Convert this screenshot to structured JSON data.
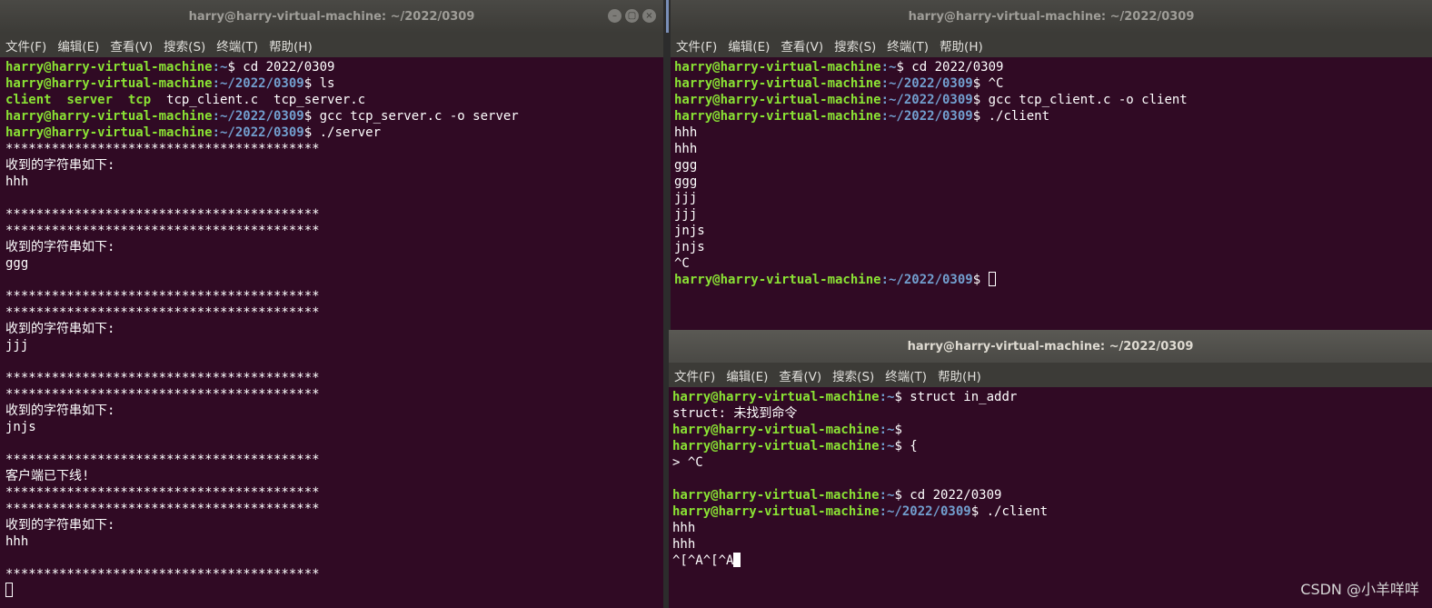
{
  "left_window": {
    "title": "harry@harry-virtual-machine: ~/2022/0309",
    "menu": [
      "文件(F)",
      "编辑(E)",
      "查看(V)",
      "搜索(S)",
      "终端(T)",
      "帮助(H)"
    ],
    "lines": [
      {
        "user": "harry@harry-virtual-machine",
        "path": ":~",
        "cmd": "$ cd 2022/0309"
      },
      {
        "user": "harry@harry-virtual-machine",
        "path": ":~/2022/0309",
        "cmd": "$ ls"
      },
      {
        "listing": "client  server  tcp  ",
        "rest": "tcp_client.c  tcp_server.c"
      },
      {
        "user": "harry@harry-virtual-machine",
        "path": ":~/2022/0309",
        "cmd": "$ gcc tcp_server.c -o server"
      },
      {
        "user": "harry@harry-virtual-machine",
        "path": ":~/2022/0309",
        "cmd": "$ ./server"
      },
      {
        "text": "*****************************************"
      },
      {
        "text": "收到的字符串如下:"
      },
      {
        "text": "hhh"
      },
      {
        "text": ""
      },
      {
        "text": "*****************************************"
      },
      {
        "text": "*****************************************"
      },
      {
        "text": "收到的字符串如下:"
      },
      {
        "text": "ggg"
      },
      {
        "text": ""
      },
      {
        "text": "*****************************************"
      },
      {
        "text": "*****************************************"
      },
      {
        "text": "收到的字符串如下:"
      },
      {
        "text": "jjj"
      },
      {
        "text": ""
      },
      {
        "text": "*****************************************"
      },
      {
        "text": "*****************************************"
      },
      {
        "text": "收到的字符串如下:"
      },
      {
        "text": "jnjs"
      },
      {
        "text": ""
      },
      {
        "text": "*****************************************"
      },
      {
        "text": "客户端已下线!"
      },
      {
        "text": "*****************************************"
      },
      {
        "text": "*****************************************"
      },
      {
        "text": "收到的字符串如下:"
      },
      {
        "text": "hhh"
      },
      {
        "text": ""
      },
      {
        "text": "*****************************************"
      },
      {
        "cursor": "hollow"
      }
    ]
  },
  "right_top_window": {
    "title": "harry@harry-virtual-machine: ~/2022/0309",
    "menu": [
      "文件(F)",
      "编辑(E)",
      "查看(V)",
      "搜索(S)",
      "终端(T)",
      "帮助(H)"
    ],
    "lines": [
      {
        "user": "harry@harry-virtual-machine",
        "path": ":~",
        "cmd": "$ cd 2022/0309"
      },
      {
        "user": "harry@harry-virtual-machine",
        "path": ":~/2022/0309",
        "cmd": "$ ^C"
      },
      {
        "user": "harry@harry-virtual-machine",
        "path": ":~/2022/0309",
        "cmd": "$ gcc tcp_client.c -o client"
      },
      {
        "user": "harry@harry-virtual-machine",
        "path": ":~/2022/0309",
        "cmd": "$ ./client"
      },
      {
        "text": "hhh"
      },
      {
        "text": "hhh"
      },
      {
        "text": "ggg"
      },
      {
        "text": "ggg"
      },
      {
        "text": "jjj"
      },
      {
        "text": "jjj"
      },
      {
        "text": "jnjs"
      },
      {
        "text": "jnjs"
      },
      {
        "text": "^C"
      },
      {
        "user": "harry@harry-virtual-machine",
        "path": ":~/2022/0309",
        "cmd": "$ ",
        "cursor": "hollow"
      }
    ]
  },
  "right_bottom_window": {
    "title": "harry@harry-virtual-machine: ~/2022/0309",
    "menu": [
      "文件(F)",
      "编辑(E)",
      "查看(V)",
      "搜索(S)",
      "终端(T)",
      "帮助(H)"
    ],
    "lines": [
      {
        "user": "harry@harry-virtual-machine",
        "path": ":~",
        "cmd": "$ struct in_addr"
      },
      {
        "text": "struct: 未找到命令"
      },
      {
        "user": "harry@harry-virtual-machine",
        "path": ":~",
        "cmd": "$"
      },
      {
        "user": "harry@harry-virtual-machine",
        "path": ":~",
        "cmd": "$ {"
      },
      {
        "text": "> ^C"
      },
      {
        "text": ""
      },
      {
        "user": "harry@harry-virtual-machine",
        "path": ":~",
        "cmd": "$ cd 2022/0309"
      },
      {
        "user": "harry@harry-virtual-machine",
        "path": ":~/2022/0309",
        "cmd": "$ ./client"
      },
      {
        "text": "hhh"
      },
      {
        "text": "hhh"
      },
      {
        "text": "^[^A^[^A",
        "cursor": "solid"
      }
    ]
  },
  "watermark": "CSDN @小羊咩咩",
  "colors": {
    "terminal_bg": "#300a24",
    "user_green": "#8ae234",
    "path_blue": "#729fcf",
    "titlebar": "#3c3b37"
  }
}
